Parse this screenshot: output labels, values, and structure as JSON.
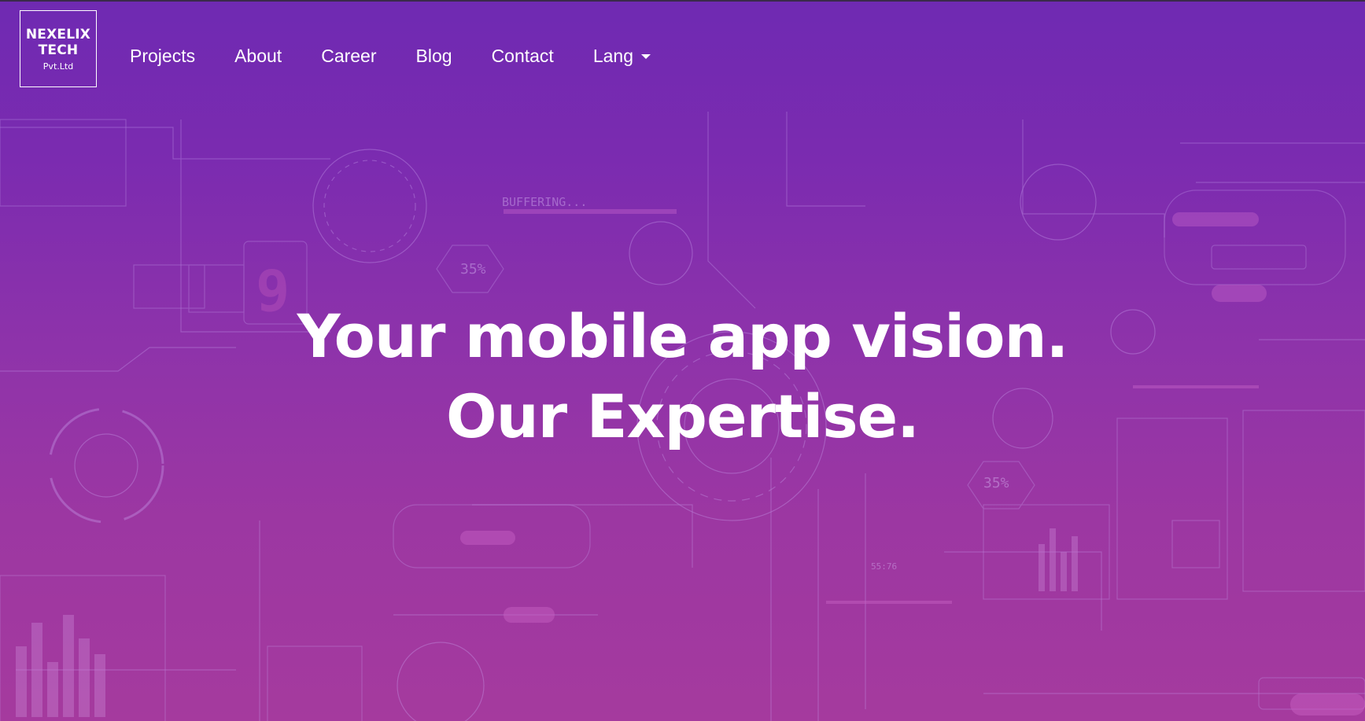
{
  "logo": {
    "line1": "NEXELIX",
    "line2": "TECH",
    "line3": "Pvt.Ltd"
  },
  "nav": {
    "items": [
      {
        "label": "Projects"
      },
      {
        "label": "About"
      },
      {
        "label": "Career"
      },
      {
        "label": "Blog"
      },
      {
        "label": "Contact"
      }
    ],
    "lang": {
      "label": "Lang",
      "icon": "chevron-down-icon"
    }
  },
  "hero": {
    "line1": "Your mobile app vision.",
    "line2": "Our Expertise."
  },
  "background_art": {
    "buffering": "BUFFERING...",
    "percent1": "35%",
    "percent2": "35%",
    "digit": "9",
    "clock": "55:76"
  },
  "colors": {
    "gradient_top": "#6f2ab2",
    "gradient_bottom": "#a53a9e",
    "text": "#ffffff"
  }
}
